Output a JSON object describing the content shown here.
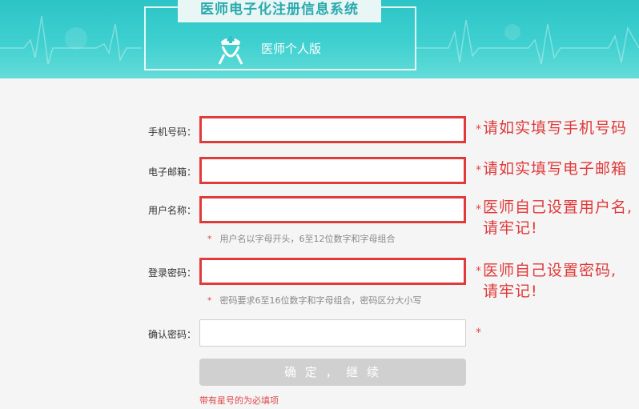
{
  "header": {
    "title": "医师电子化注册信息系统",
    "subtitle": "医师个人版"
  },
  "form": {
    "phone": {
      "label": "手机号码：",
      "value": "",
      "star": "*",
      "note": "请如实填写手机号码"
    },
    "email": {
      "label": "电子邮箱：",
      "value": "",
      "star": "*",
      "note": "请如实填写电子邮箱"
    },
    "username": {
      "label": "用户名称：",
      "value": "",
      "star": "*",
      "note_line1": "医师自己设置用户名,",
      "note_line2": "请牢记!",
      "hint_star": "*",
      "hint": "用户名以字母开头，6至12位数字和字母组合"
    },
    "password": {
      "label": "登录密码：",
      "value": "",
      "star": "*",
      "note_line1": "医师自己设置密码,",
      "note_line2": "请牢记!",
      "hint_star": "*",
      "hint": "密码要求6至16位数字和字母组合，密码区分大小写"
    },
    "confirm": {
      "label": "确认密码：",
      "value": "",
      "star": "*"
    },
    "submit_label": "确 定 ， 继 续",
    "required_note": "带有星号的为必填项"
  },
  "colors": {
    "banner": "#2cc4c6",
    "alert": "#e03a3a",
    "button": "#d0d0d0"
  }
}
